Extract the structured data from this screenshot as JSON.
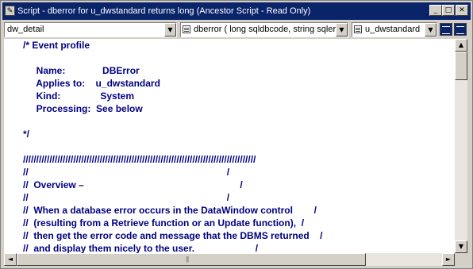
{
  "window": {
    "title": "Script - dberror for u_dwstandard returns long (Ancestor Script - Read Only)",
    "controls": {
      "minimize": "_",
      "maximize": "□",
      "close": "✕"
    }
  },
  "toolbar": {
    "object_combo": "dw_detail",
    "event_combo": "dberror ( long sqldbcode, string sqlerrtext",
    "ancestor_combo": "u_dwstandard"
  },
  "editor": {
    "lines": [
      "/* Event profile",
      "",
      "     Name:              DBError",
      "     Applies to:    u_dwstandard",
      "     Kind:               System",
      "     Processing:  See below",
      "",
      "*/",
      "",
      "////////////////////////////////////////////////////////////////////////////////////////",
      "//                                                                           /",
      "//  Overview –                                                           /",
      "//                                                                           /",
      "//  When a database error occurs in the DataWindow control        /",
      "//  (resulting from a Retrieve function or an Update function),  /",
      "//  then get the error code and message that the DBMS returned    /",
      "//  and display them nicely to the user.                       /"
    ]
  },
  "scrollbars": {
    "vertical": {
      "up": "▲",
      "down": "▼"
    },
    "horizontal": {
      "left": "◄",
      "right": "►",
      "grip": "|||"
    }
  },
  "colors": {
    "code_text": "#000080",
    "titlebar": "#0a246a",
    "chrome": "#d4d0c8"
  }
}
